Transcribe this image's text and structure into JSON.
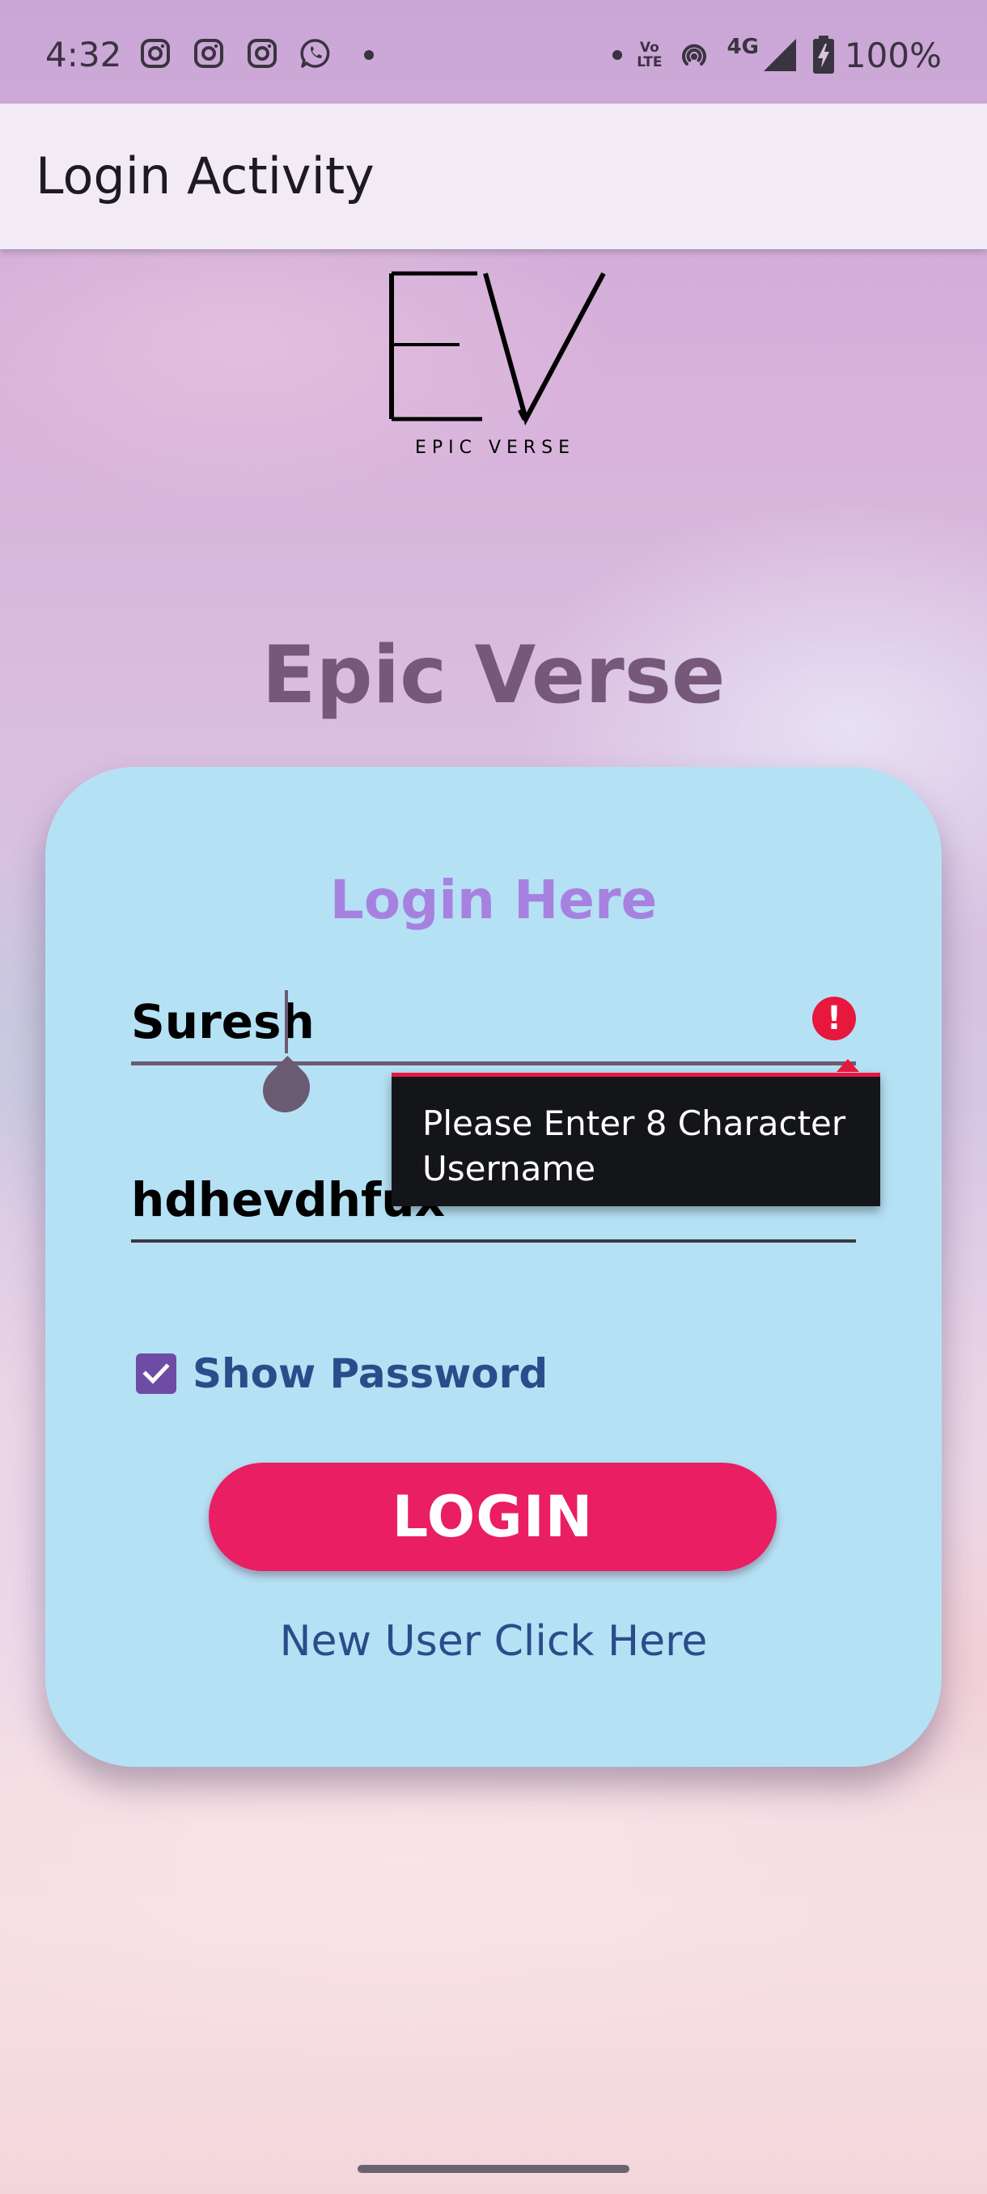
{
  "status_bar": {
    "time": "4:32",
    "battery": "100%",
    "network": "4G",
    "volte_top": "Vo",
    "volte_bottom": "LTE",
    "notification_icons": [
      "instagram-icon",
      "instagram-icon",
      "instagram-icon",
      "whatsapp-icon",
      "more-dot-icon"
    ]
  },
  "app_bar": {
    "title": "Login Activity"
  },
  "logo": {
    "letters": "EV",
    "tagline": "EPIC VERSE"
  },
  "brand_title": "Epic Verse",
  "card": {
    "title": "Login Here",
    "username_value": "Suresh",
    "password_value": "hdhevdhfux",
    "error_message": "Please Enter 8 Character Username",
    "show_password_label": "Show Password",
    "show_password_checked": true,
    "login_button_label": "LOGIN",
    "new_user_link": "New User Click Here"
  },
  "colors": {
    "card_background": "#b5e1f5",
    "brand_title": "#76597a",
    "card_title": "#a781e0",
    "login_button": "#e91e63",
    "error": "#e8173e",
    "checkbox": "#6e4ca6",
    "link": "#2a4d8a"
  }
}
